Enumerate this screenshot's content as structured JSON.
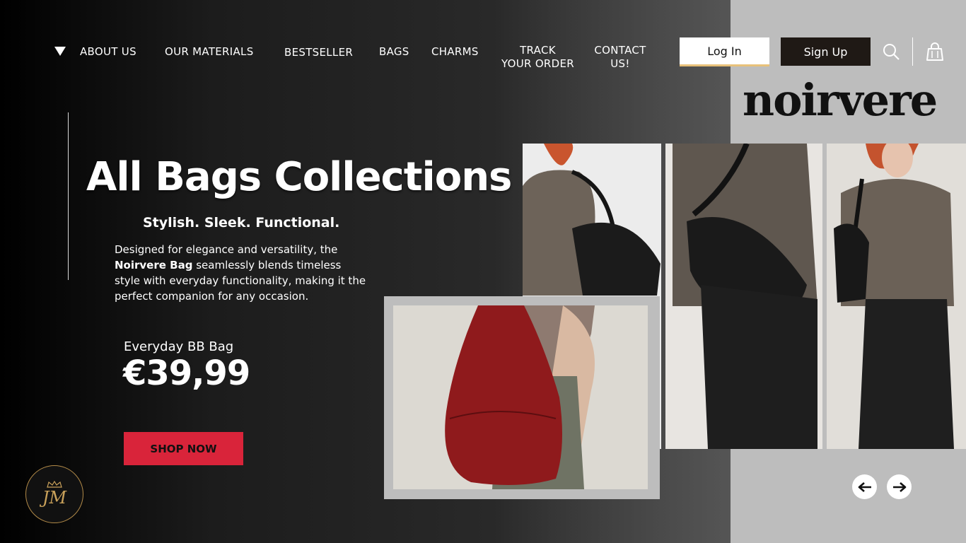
{
  "nav": {
    "items": [
      "ABOUT US",
      "OUR MATERIALS",
      "BESTSELLER",
      "BAGS",
      "CHARMS"
    ],
    "track_line1": "TRACK",
    "track_line2": "YOUR ORDER",
    "contact_line1": "CONTACT",
    "contact_line2": "US!",
    "login_label": "Log In",
    "signup_label": "Sign Up"
  },
  "brand": {
    "logo_text": "noirvere"
  },
  "hero": {
    "title": "All Bags Collections",
    "subtitle": "Stylish. Sleek. Functional.",
    "desc_part1": "Designed for elegance and versatility, the",
    "desc_bold": "Noirvere Bag",
    "desc_part2": "seamlessly blends timeless style with everyday functionality, making it the perfect companion for any occasion."
  },
  "product": {
    "name": "Everyday BB Bag",
    "price": "€39,99",
    "cta_label": "SHOP NOW"
  },
  "badge": {
    "text": "JM"
  },
  "icons": [
    "caret-down-icon",
    "search-icon",
    "shopping-bag-icon",
    "arrow-left-icon",
    "arrow-right-icon"
  ],
  "colors": {
    "accent": "#d9243a",
    "panel": "#bdbdbd",
    "signup_bg": "#1f1915"
  }
}
